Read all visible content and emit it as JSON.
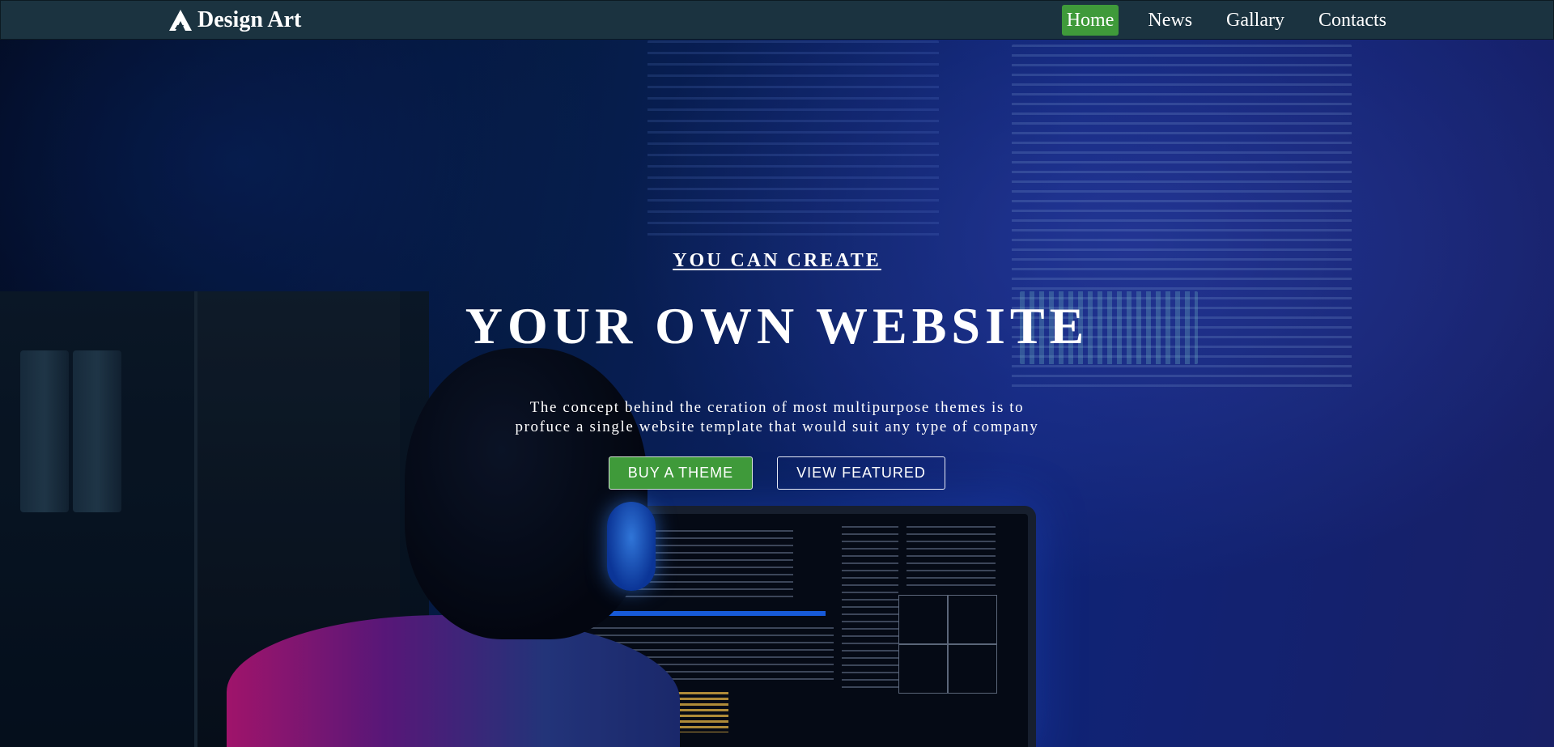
{
  "brand": {
    "name": "Design Art",
    "icon": "logo-triangle-icon"
  },
  "nav": {
    "items": [
      {
        "label": "Home",
        "active": true
      },
      {
        "label": "News",
        "active": false
      },
      {
        "label": "Gallary",
        "active": false
      },
      {
        "label": "Contacts",
        "active": false
      }
    ]
  },
  "hero": {
    "eyebrow": "YOU CAN CREATE",
    "headline": "YOUR OWN WEBSITE",
    "description_line1": "The concept behind the ceration of most multipurpose themes is to",
    "description_line2": "profuce a single website template that would suit any type of company",
    "primary_button": "BUY A THEME",
    "secondary_button": "VIEW FEATURED"
  },
  "colors": {
    "navbar_bg": "#1b3340",
    "accent_green": "#3f9a3a",
    "text": "#ffffff"
  }
}
